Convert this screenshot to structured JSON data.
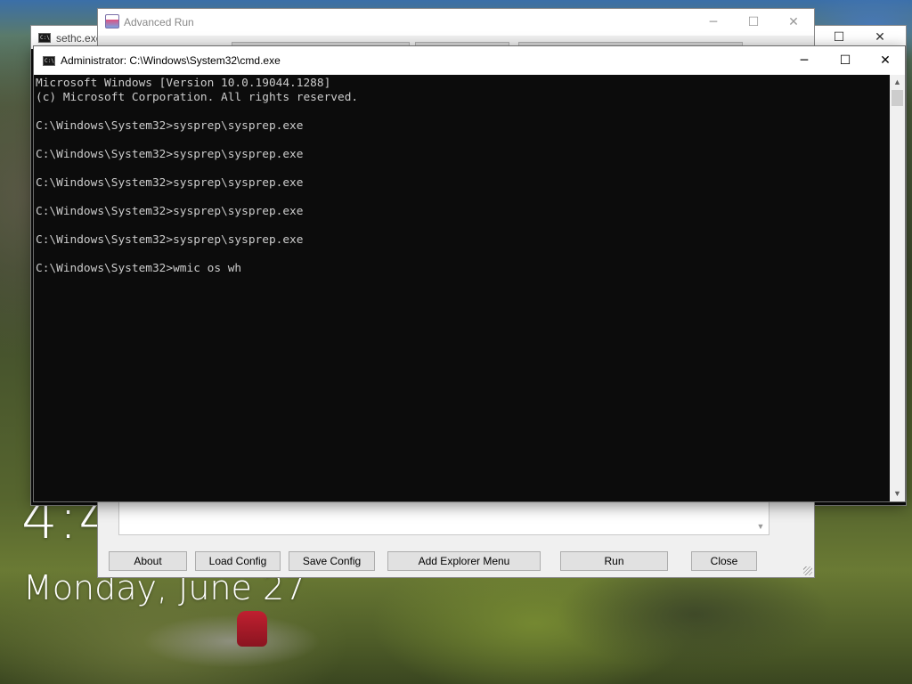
{
  "desktop": {
    "time": "4:4",
    "date": "Monday, June 27"
  },
  "sethc_window": {
    "title": "sethc.exe",
    "icon": "cmd-icon",
    "minimize": "─",
    "maximize": "☐",
    "close": "✕"
  },
  "advanced_run": {
    "title": "Advanced Run",
    "icon": "advanced-run-icon",
    "minimize": "─",
    "maximize": "☐",
    "close": "✕",
    "buttons": {
      "about": "About",
      "load_config": "Load Config",
      "save_config": "Save Config",
      "add_explorer_menu": "Add Explorer Menu",
      "run": "Run",
      "close": "Close"
    }
  },
  "cmd_window": {
    "title": "Administrator: C:\\Windows\\System32\\cmd.exe",
    "icon": "cmd-icon",
    "minimize": "─",
    "maximize": "☐",
    "close": "✕",
    "console_lines": [
      "Microsoft Windows [Version 10.0.19044.1288]",
      "(c) Microsoft Corporation. All rights reserved.",
      "",
      "C:\\Windows\\System32>sysprep\\sysprep.exe",
      "",
      "C:\\Windows\\System32>sysprep\\sysprep.exe",
      "",
      "C:\\Windows\\System32>sysprep\\sysprep.exe",
      "",
      "C:\\Windows\\System32>sysprep\\sysprep.exe",
      "",
      "C:\\Windows\\System32>sysprep\\sysprep.exe",
      "",
      "C:\\Windows\\System32>wmic os wh"
    ]
  },
  "colors": {
    "console_bg": "#0c0c0c",
    "console_text": "#cccccc",
    "button_face": "#e1e1e1",
    "window_bg": "#f0f0f0"
  }
}
